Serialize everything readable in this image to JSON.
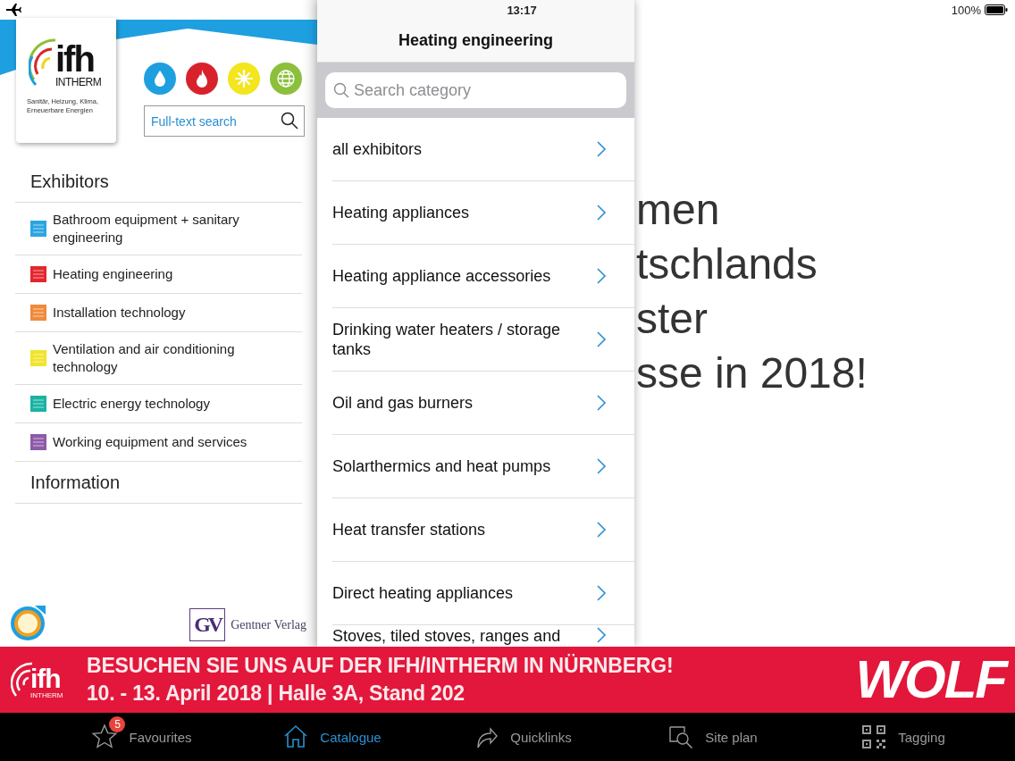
{
  "status_bar": {
    "time": "13:17",
    "battery": "100%"
  },
  "sidebar": {
    "logo": {
      "wordmark": "ifh",
      "name": "INTHERM",
      "tagline": [
        "Sanitär, Heizung, Klima,",
        "Erneuerbare Energien"
      ]
    },
    "search": {
      "placeholder": "Full-text search"
    },
    "sections": [
      {
        "title": "Exhibitors",
        "items": [
          {
            "label": "Bathroom equipment + sanitary engineering",
            "color": "#2ba5e0"
          },
          {
            "label": "Heating engineering",
            "color": "#e3262d"
          },
          {
            "label": "Installation technology",
            "color": "#ee8a3c"
          },
          {
            "label": "Ventilation and air conditioning technology",
            "color": "#f1e42c"
          },
          {
            "label": "Electric energy technology",
            "color": "#1ab2a3"
          },
          {
            "label": "Working equipment and services",
            "color": "#8d5aa8"
          }
        ]
      },
      {
        "title": "Information"
      }
    ],
    "publisher": {
      "mark": "GV",
      "name": "Gentner Verlag"
    }
  },
  "category_panel": {
    "title": "Heating engineering",
    "search": {
      "placeholder": "Search category"
    },
    "rows": [
      {
        "label": "all exhibitors"
      },
      {
        "label": "Heating appliances"
      },
      {
        "label": "Heating appliance accessories"
      },
      {
        "label": "Drinking water heaters / storage tanks"
      },
      {
        "label": "Oil and gas burners"
      },
      {
        "label": "Solarthermics and heat pumps"
      },
      {
        "label": "Heat transfer stations"
      },
      {
        "label": "Direct heating appliances"
      },
      {
        "label": "Stoves, tiled stoves, ranges and"
      }
    ]
  },
  "headline": {
    "lines": [
      "men",
      "tschlands",
      "ster",
      "sse in 2018!"
    ]
  },
  "ad_banner": {
    "logo": {
      "wordmark": "ifh",
      "name": "INTHERM"
    },
    "lines": [
      "BESUCHEN SIE UNS AUF DER IFH/INTHERM IN NÜRNBERG!",
      "10. - 13. April 2018 | Halle 3A, Stand 202"
    ],
    "sponsor": "WOLF"
  },
  "tab_bar": [
    {
      "kind": "star",
      "label": "Favourites",
      "badge": "5",
      "selected": false
    },
    {
      "kind": "home",
      "label": "Catalogue",
      "selected": true
    },
    {
      "kind": "share",
      "label": "Quicklinks",
      "selected": false
    },
    {
      "kind": "map",
      "label": "Site plan",
      "selected": false
    },
    {
      "kind": "qr",
      "label": "Tagging",
      "selected": false
    }
  ]
}
